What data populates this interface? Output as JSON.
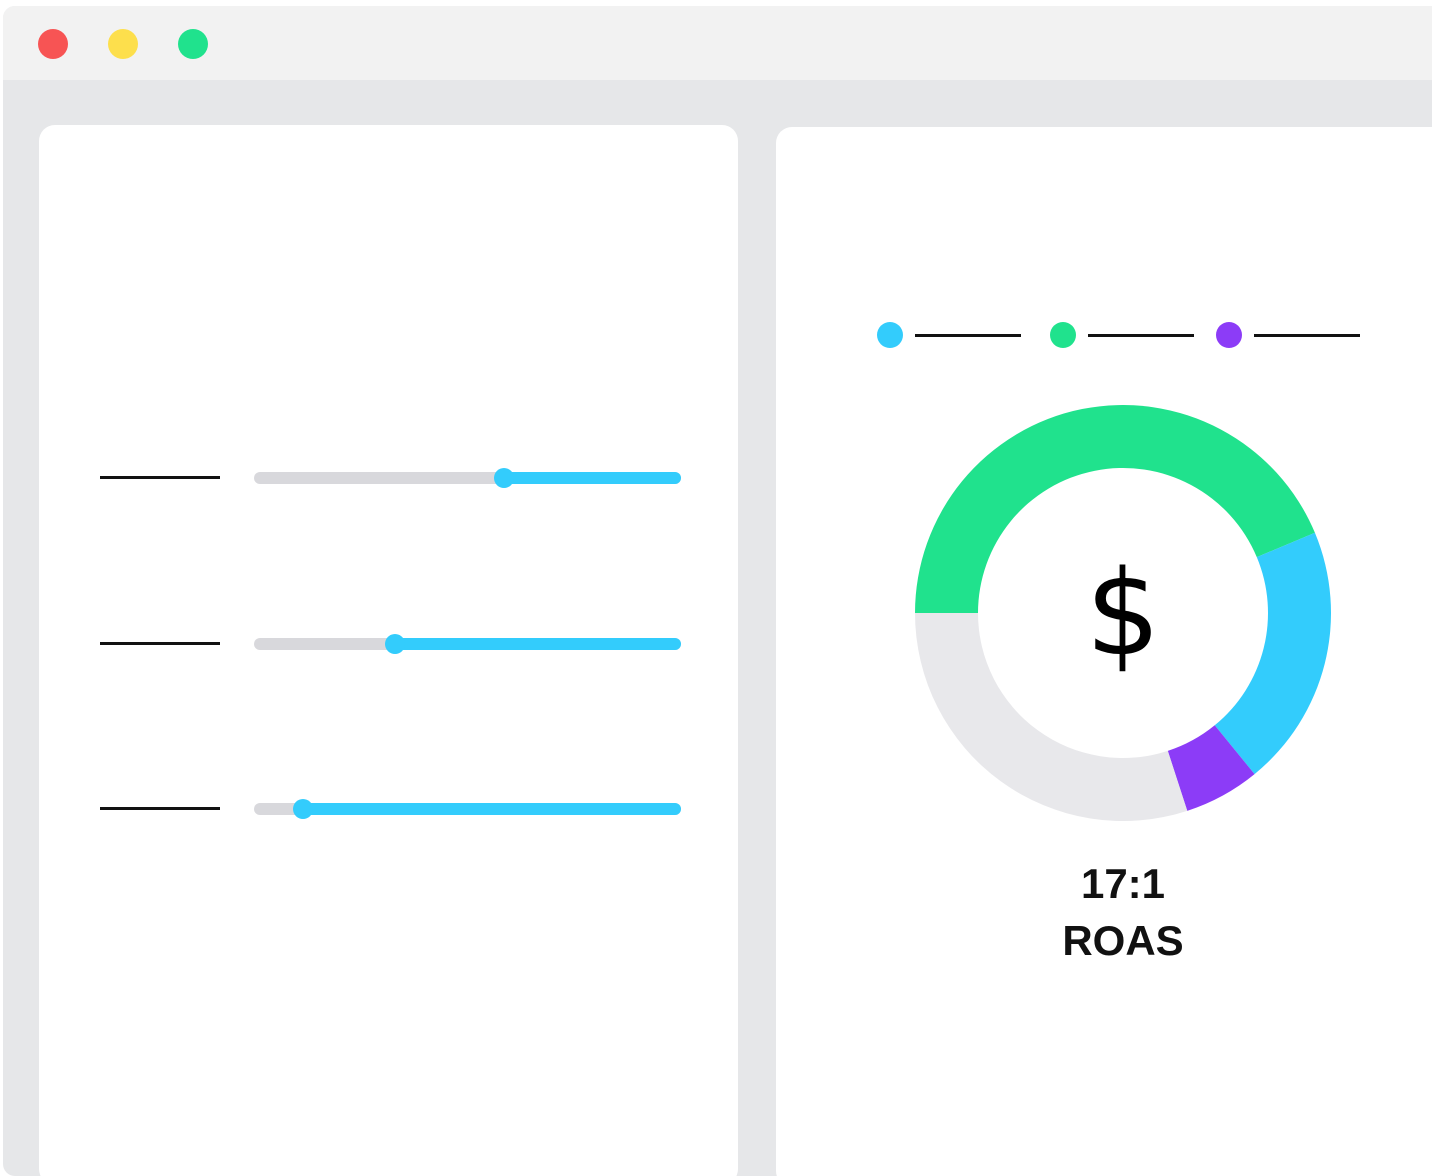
{
  "window": {
    "traffic_lights": [
      {
        "name": "close",
        "color": "#f75454"
      },
      {
        "name": "minimize",
        "color": "#fddf4c"
      },
      {
        "name": "maximize",
        "color": "#20e28d"
      }
    ]
  },
  "sliders": [
    {
      "value_fraction": 0.585,
      "fill_color": "#33ccfc",
      "track_color": "#d8d8dc"
    },
    {
      "value_fraction": 0.33,
      "fill_color": "#33ccfc",
      "track_color": "#d8d8dc"
    },
    {
      "value_fraction": 0.115,
      "fill_color": "#33ccfc",
      "track_color": "#d8d8dc"
    }
  ],
  "legend": [
    {
      "color": "#33ccfc"
    },
    {
      "color": "#20e28d"
    },
    {
      "color": "#8c3cf7"
    }
  ],
  "chart_data": {
    "type": "pie",
    "donut": true,
    "remainder_color": "#e8e8eb",
    "slices": [
      {
        "value": 43.7,
        "color": "#20e28d"
      },
      {
        "value": 20.4,
        "color": "#33ccfc"
      },
      {
        "value": 5.9,
        "color": "#8c3cf7"
      },
      {
        "value": 30.0,
        "color": "#e8e8eb"
      }
    ]
  },
  "center_symbol": "$",
  "metric": {
    "value": "17:1",
    "label": "ROAS"
  }
}
